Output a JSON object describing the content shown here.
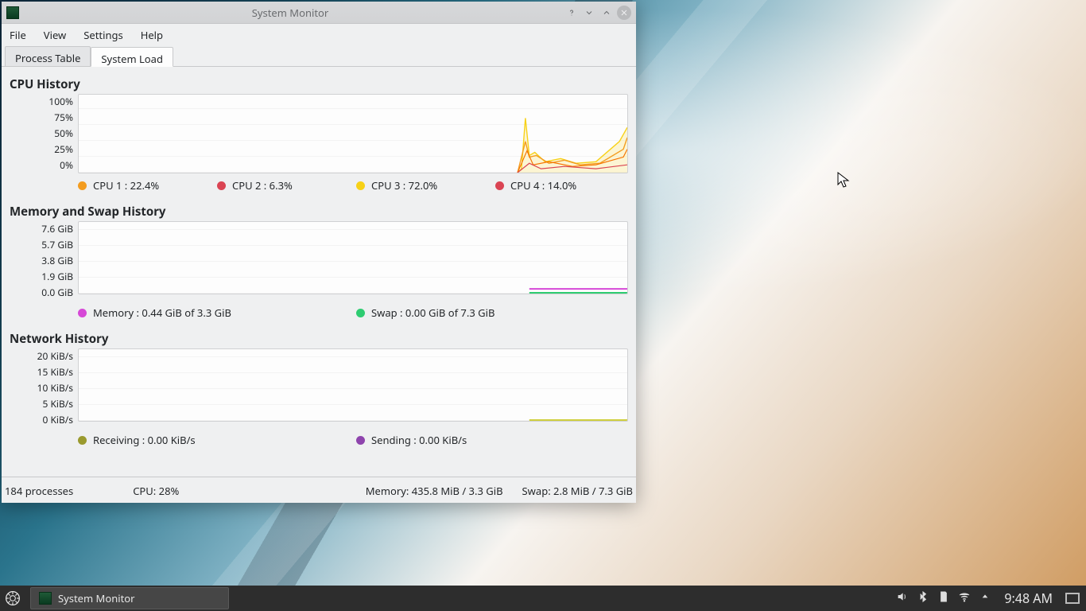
{
  "window": {
    "title": "System Monitor"
  },
  "menu": {
    "file": "File",
    "view": "View",
    "settings": "Settings",
    "help": "Help"
  },
  "tabs": {
    "process": "Process Table",
    "load": "System Load"
  },
  "cpu": {
    "title": "CPU History",
    "yticks": [
      "100%",
      "75%",
      "50%",
      "25%",
      "0%"
    ],
    "legend1": "CPU 1 : 22.4%",
    "legend2": "CPU 2 : 6.3%",
    "legend3": "CPU 3 : 72.0%",
    "legend4": "CPU 4 : 14.0%"
  },
  "mem": {
    "title": "Memory and Swap History",
    "yticks": [
      "7.6 GiB",
      "5.7 GiB",
      "3.8 GiB",
      "1.9 GiB",
      "0.0 GiB"
    ],
    "legend_mem": "Memory : 0.44 GiB of 3.3 GiB",
    "legend_swap": "Swap : 0.00 GiB of 7.3 GiB"
  },
  "net": {
    "title": "Network History",
    "yticks": [
      "20 KiB/s",
      "15 KiB/s",
      "10 KiB/s",
      "5 KiB/s",
      "0 KiB/s"
    ],
    "legend_rx": "Receiving : 0.00 KiB/s",
    "legend_tx": "Sending : 0.00 KiB/s"
  },
  "status": {
    "procs": "184 processes",
    "cpu": "CPU: 28%",
    "mem": "Memory: 435.8 MiB / 3.3 GiB",
    "swap": "Swap: 2.8 MiB / 7.3 GiB"
  },
  "taskbar": {
    "task": "System Monitor",
    "clock": "9:48 AM"
  },
  "chart_data": [
    {
      "type": "line",
      "title": "CPU History",
      "ylabel": "%",
      "ylim": [
        0,
        100
      ],
      "yticks": [
        0,
        25,
        50,
        75,
        100
      ],
      "legend": [
        "CPU 1",
        "CPU 2",
        "CPU 3",
        "CPU 4"
      ],
      "series": [
        {
          "name": "CPU 1",
          "value": 22.4,
          "color": "#f39c1f"
        },
        {
          "name": "CPU 2",
          "value": 6.3,
          "color": "#da4453"
        },
        {
          "name": "CPU 3",
          "value": 72.0,
          "color": "#f7d117"
        },
        {
          "name": "CPU 4",
          "value": 14.0,
          "color": "#f67400"
        }
      ],
      "note": "Only the most recent ~20% of the time axis contains activity; earlier region is ~0 for all CPUs. The recent window shows a brief spike of roughly: CPU3~72, CPU1~22, CPU4~14, CPU2~6 (percent), then settling near 10–15%."
    },
    {
      "type": "line",
      "title": "Memory and Swap History",
      "ylabel": "GiB",
      "ylim": [
        0,
        7.6
      ],
      "yticks": [
        0.0,
        1.9,
        3.8,
        5.7,
        7.6
      ],
      "series": [
        {
          "name": "Memory",
          "values_recent": [
            0.44
          ],
          "total": 3.3,
          "color": "#d648d7"
        },
        {
          "name": "Swap",
          "values_recent": [
            0.0
          ],
          "total": 7.3,
          "color": "#2ecc71"
        }
      ]
    },
    {
      "type": "line",
      "title": "Network History",
      "ylabel": "KiB/s",
      "ylim": [
        0,
        20
      ],
      "yticks": [
        0,
        5,
        10,
        15,
        20
      ],
      "series": [
        {
          "name": "Receiving",
          "values_recent": [
            0.0
          ],
          "color": "#9a9a2e"
        },
        {
          "name": "Sending",
          "values_recent": [
            0.0
          ],
          "color": "#8e44ad"
        }
      ]
    }
  ]
}
